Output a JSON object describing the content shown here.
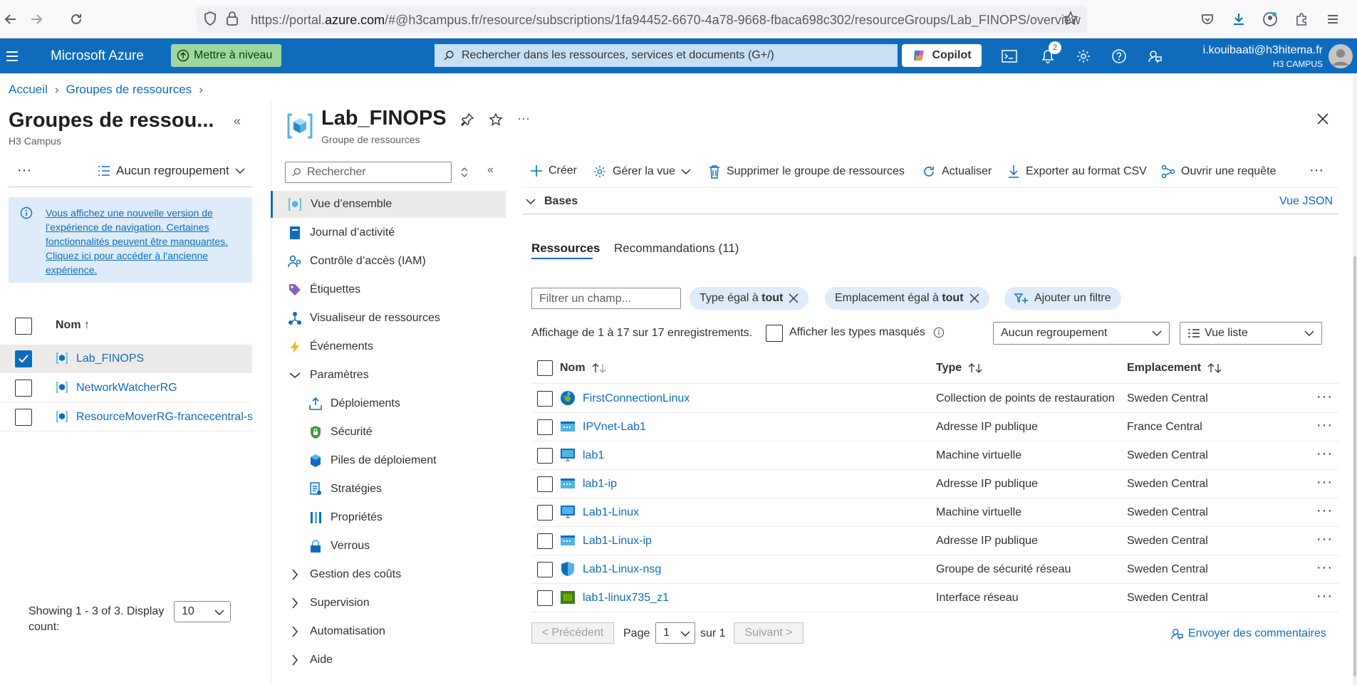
{
  "browser": {
    "url_prefix": "https://portal.",
    "url_domain": "azure.com",
    "url_rest": "/#@h3campus.fr/resource/subscriptions/1fa94452-6670-4a78-9668-fbaca698c302/resourceGroups/Lab_FINOPS/overview"
  },
  "header": {
    "brand": "Microsoft Azure",
    "upgrade_label": "Mettre à niveau",
    "search_placeholder": "Rechercher dans les ressources, services et documents (G+/)",
    "copilot_label": "Copilot",
    "notification_count": "2",
    "user_email": "i.kouibaati@h3hitema.fr",
    "user_org": "H3 CAMPUS"
  },
  "breadcrumb": {
    "home": "Accueil",
    "groups": "Groupes de ressources"
  },
  "left_panel": {
    "title": "Groupes de ressou...",
    "subtitle": "H3 Campus",
    "grouping": "Aucun regroupement",
    "notice": "Vous affichez une nouvelle version de l’expérience de navigation. Certaines fonctionnalités peuvent être manquantes. Cliquez ici pour accéder à l’ancienne expérience.",
    "name_header": "Nom ↑",
    "rows": [
      {
        "name": "Lab_FINOPS",
        "selected": true
      },
      {
        "name": "NetworkWatcherRG",
        "selected": false
      },
      {
        "name": "ResourceMoverRG-francecentral-sw",
        "selected": false
      }
    ],
    "showing": "Showing 1 - 3 of 3. Display count:",
    "display_count": "10"
  },
  "resource_group": {
    "title": "Lab_FINOPS",
    "subtitle": "Groupe de ressources",
    "more": "···"
  },
  "nav": {
    "search_placeholder": "Rechercher",
    "items": [
      {
        "label": "Vue d’ensemble",
        "icon": "overview-icon",
        "indent": 0,
        "active": true
      },
      {
        "label": "Journal d’activité",
        "icon": "activity-log-icon",
        "indent": 0
      },
      {
        "label": "Contrôle d’accès (IAM)",
        "icon": "iam-icon",
        "indent": 0
      },
      {
        "label": "Étiquettes",
        "icon": "tag-icon",
        "indent": 0
      },
      {
        "label": "Visualiseur de ressources",
        "icon": "visualizer-icon",
        "indent": 0
      },
      {
        "label": "Événements",
        "icon": "events-icon",
        "indent": 0
      },
      {
        "label": "Paramètres",
        "icon": "chevron-down-icon",
        "indent": 0,
        "expander": true
      },
      {
        "label": "Déploiements",
        "icon": "deployments-icon",
        "indent": 1
      },
      {
        "label": "Sécurité",
        "icon": "security-icon",
        "indent": 1
      },
      {
        "label": "Piles de déploiement",
        "icon": "stacks-icon",
        "indent": 1
      },
      {
        "label": "Stratégies",
        "icon": "policies-icon",
        "indent": 1
      },
      {
        "label": "Propriétés",
        "icon": "properties-icon",
        "indent": 1
      },
      {
        "label": "Verrous",
        "icon": "lock-icon",
        "indent": 1
      },
      {
        "label": "Gestion des coûts",
        "icon": "chevron-right-icon",
        "indent": 0,
        "expander": true
      },
      {
        "label": "Supervision",
        "icon": "chevron-right-icon",
        "indent": 0,
        "expander": true
      },
      {
        "label": "Automatisation",
        "icon": "chevron-right-icon",
        "indent": 0,
        "expander": true
      },
      {
        "label": "Aide",
        "icon": "chevron-right-icon",
        "indent": 0,
        "expander": true
      }
    ]
  },
  "toolbar": {
    "create": "Créer",
    "manage_view": "Gérer la vue",
    "delete_group": "Supprimer le groupe de ressources",
    "refresh": "Actualiser",
    "export_csv": "Exporter au format CSV",
    "open_query": "Ouvrir une requête",
    "more": "···"
  },
  "bases": {
    "label": "Bases",
    "json_view": "Vue JSON"
  },
  "tabs": {
    "resources": "Ressources",
    "recommendations": "Recommandations (11)"
  },
  "filters": {
    "field_placeholder": "Filtrer un champ...",
    "type_prefix": "Type égal à ",
    "type_value": "tout",
    "location_prefix": "Emplacement égal à ",
    "location_value": "tout",
    "add_filter": "Ajouter un filtre"
  },
  "listing": {
    "summary": "Affichage de 1 à 17 sur 17 enregistrements.",
    "show_hidden": "Afficher les types masqués",
    "grouping": "Aucun regroupement",
    "view": "Vue liste"
  },
  "table": {
    "headers": {
      "name": "Nom",
      "type": "Type",
      "location": "Emplacement"
    },
    "rows": [
      {
        "name": "FirstConnectionLinux",
        "type": "Collection de points de restauration",
        "location": "Sweden Central",
        "icon": "restore-point-icon"
      },
      {
        "name": "IPVnet-Lab1",
        "type": "Adresse IP publique",
        "location": "France Central",
        "icon": "public-ip-icon"
      },
      {
        "name": "lab1",
        "type": "Machine virtuelle",
        "location": "Sweden Central",
        "icon": "vm-icon"
      },
      {
        "name": "lab1-ip",
        "type": "Adresse IP publique",
        "location": "Sweden Central",
        "icon": "public-ip-icon"
      },
      {
        "name": "Lab1-Linux",
        "type": "Machine virtuelle",
        "location": "Sweden Central",
        "icon": "vm-icon"
      },
      {
        "name": "Lab1-Linux-ip",
        "type": "Adresse IP publique",
        "location": "Sweden Central",
        "icon": "public-ip-icon"
      },
      {
        "name": "Lab1-Linux-nsg",
        "type": "Groupe de sécurité réseau",
        "location": "Sweden Central",
        "icon": "nsg-icon"
      },
      {
        "name": "lab1-linux735_z1",
        "type": "Interface réseau",
        "location": "Sweden Central",
        "icon": "nic-icon"
      }
    ]
  },
  "pagination": {
    "prev": "< Précédent",
    "page_label": "Page",
    "page_value": "1",
    "of": "sur 1",
    "next": "Suivant >"
  },
  "feedback": "Envoyer des commentaires",
  "colors": {
    "accent": "#0f6cbd",
    "header": "#0f6cbd",
    "upgrade": "#9fd89f"
  }
}
